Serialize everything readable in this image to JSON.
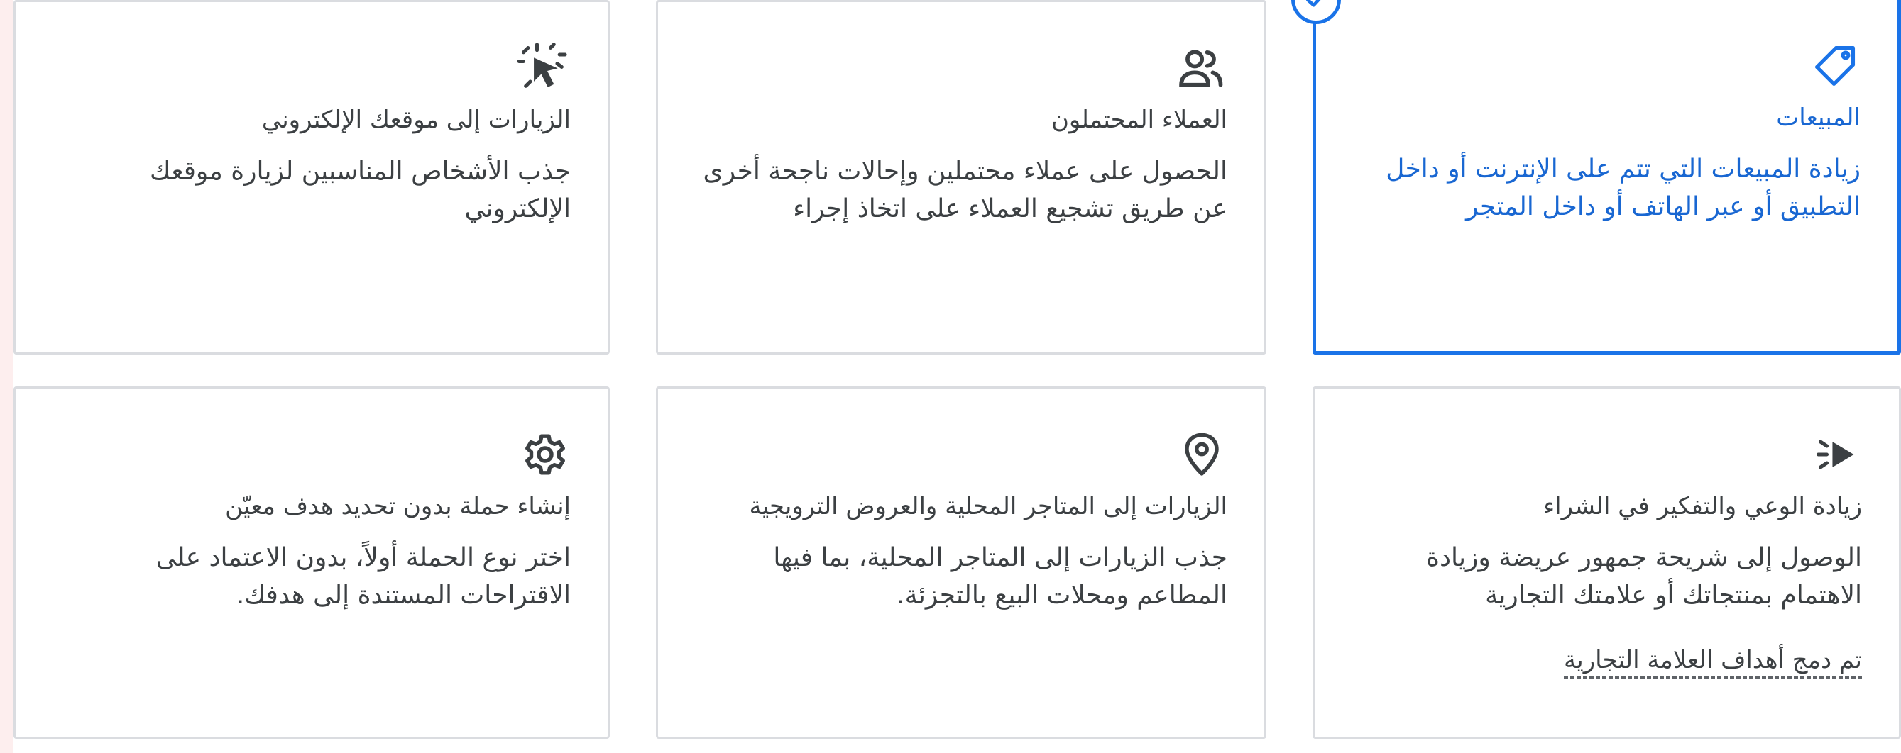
{
  "colors": {
    "accent": "#1a73e8",
    "accent_text": "#1967d2",
    "text": "#3c4043",
    "border": "#dadce0"
  },
  "goals": [
    {
      "icon": "tag-icon",
      "title": "المبيعات",
      "description": "زيادة المبيعات التي تتم على الإنترنت أو داخل التطبيق أو عبر الهاتف أو داخل المتجر",
      "selected": true
    },
    {
      "icon": "people-icon",
      "title": "العملاء المحتملون",
      "description": "الحصول على عملاء محتملين وإحالات ناجحة أخرى عن طريق تشجيع العملاء على اتخاذ إجراء",
      "selected": false
    },
    {
      "icon": "cursor-click-icon",
      "title": "الزيارات إلى موقعك الإلكتروني",
      "description": "جذب الأشخاص المناسبين لزيارة موقعك الإلكتروني",
      "selected": false
    },
    {
      "icon": "awareness-play-icon",
      "title": "زيادة الوعي والتفكير في الشراء",
      "description": "الوصول إلى شريحة جمهور عريضة وزيادة الاهتمام بمنتجاتك أو علامتك التجارية",
      "link": "تم دمج أهداف العلامة التجارية",
      "selected": false
    },
    {
      "icon": "location-pin-icon",
      "title": "الزيارات إلى المتاجر المحلية والعروض الترويجية",
      "description": "جذب الزيارات إلى المتاجر المحلية، بما فيها المطاعم ومحلات البيع بالتجزئة.",
      "selected": false
    },
    {
      "icon": "gear-icon",
      "title": "إنشاء حملة بدون تحديد هدف معيّن",
      "description": "اختر نوع الحملة أولاً، بدون الاعتماد على الاقتراحات المستندة إلى هدفك.",
      "selected": false
    }
  ]
}
